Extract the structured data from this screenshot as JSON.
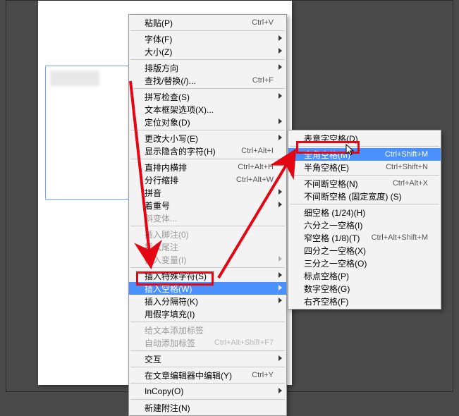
{
  "menu1": {
    "items": [
      {
        "label": "粘贴(P)",
        "shortcut": "Ctrl+V",
        "sub": false,
        "disabled": false
      },
      {
        "sep": true
      },
      {
        "label": "字体(F)",
        "sub": true,
        "disabled": false
      },
      {
        "label": "大小(Z)",
        "sub": true,
        "disabled": false
      },
      {
        "sep": true
      },
      {
        "label": "排版方向",
        "sub": true,
        "disabled": false
      },
      {
        "label": "查找/替换(/)...",
        "shortcut": "Ctrl+F",
        "disabled": false
      },
      {
        "sep": true
      },
      {
        "label": "拼写检查(S)",
        "sub": true,
        "disabled": false
      },
      {
        "label": "文本框架选项(X)...",
        "disabled": false
      },
      {
        "label": "定位对象(D)",
        "sub": true,
        "disabled": false
      },
      {
        "sep": true
      },
      {
        "label": "更改大小写(E)",
        "sub": true,
        "disabled": false
      },
      {
        "label": "显示隐含的字符(H)",
        "shortcut": "Ctrl+Alt+I",
        "disabled": false
      },
      {
        "sep": true
      },
      {
        "label": "直排内横排",
        "shortcut": "Ctrl+Alt+H",
        "disabled": false
      },
      {
        "label": "分行缩排",
        "shortcut": "Ctrl+Alt+W",
        "disabled": false
      },
      {
        "label": "拼音",
        "sub": true,
        "disabled": false
      },
      {
        "label": "着重号",
        "sub": true,
        "disabled": false
      },
      {
        "label": "斜变体...",
        "disabled": true
      },
      {
        "sep": true
      },
      {
        "label": "插入脚注(0)",
        "disabled": true
      },
      {
        "label": "插入尾注",
        "disabled": true
      },
      {
        "label": "插入变量(I)",
        "sub": true,
        "disabled": true
      },
      {
        "sep": true
      },
      {
        "label": "插入特殊字符(S)",
        "sub": true,
        "disabled": false
      },
      {
        "label": "插入空格(W)",
        "sub": true,
        "disabled": false,
        "hi": true
      },
      {
        "label": "插入分隔符(K)",
        "sub": true,
        "disabled": false
      },
      {
        "label": "用假字填充(I)",
        "disabled": false
      },
      {
        "sep": true
      },
      {
        "label": "给文本添加标签",
        "disabled": true
      },
      {
        "label": "自动添加标签",
        "shortcut": "Ctrl+Alt+Shift+F7",
        "disabled": true
      },
      {
        "sep": true
      },
      {
        "label": "交互",
        "sub": true,
        "disabled": false
      },
      {
        "sep": true
      },
      {
        "label": "在文章编辑器中编辑(Y)",
        "shortcut": "Ctrl+Y",
        "disabled": false
      },
      {
        "sep": true
      },
      {
        "label": "InCopy(O)",
        "sub": true,
        "disabled": false
      },
      {
        "sep": true
      },
      {
        "label": "新建附注(N)",
        "disabled": false
      }
    ]
  },
  "menu2": {
    "items": [
      {
        "label": "表意字空格(D)",
        "disabled": false
      },
      {
        "sep": true
      },
      {
        "label": "全角空格(M)",
        "shortcut": "Ctrl+Shift+M",
        "disabled": false,
        "hi": true
      },
      {
        "label": "半角空格(E)",
        "shortcut": "Ctrl+Shift+N",
        "disabled": false
      },
      {
        "sep": true
      },
      {
        "label": "不间断空格(N)",
        "shortcut": "Ctrl+Alt+X",
        "disabled": false
      },
      {
        "label": "不间断空格 (固定宽度) (S)",
        "disabled": false
      },
      {
        "sep": true
      },
      {
        "label": "细空格 (1/24)(H)",
        "disabled": false
      },
      {
        "label": "六分之一空格(I)",
        "disabled": false
      },
      {
        "label": "窄空格 (1/8)(T)",
        "shortcut": "Ctrl+Alt+Shift+M",
        "disabled": false
      },
      {
        "label": "四分之一空格(X)",
        "disabled": false
      },
      {
        "label": "三分之一空格(O)",
        "disabled": false
      },
      {
        "label": "标点空格(P)",
        "disabled": false
      },
      {
        "label": "数字空格(G)",
        "disabled": false
      },
      {
        "label": "右齐空格(F)",
        "disabled": false
      }
    ]
  },
  "annotation": {
    "arrow_color": "#e30613"
  }
}
